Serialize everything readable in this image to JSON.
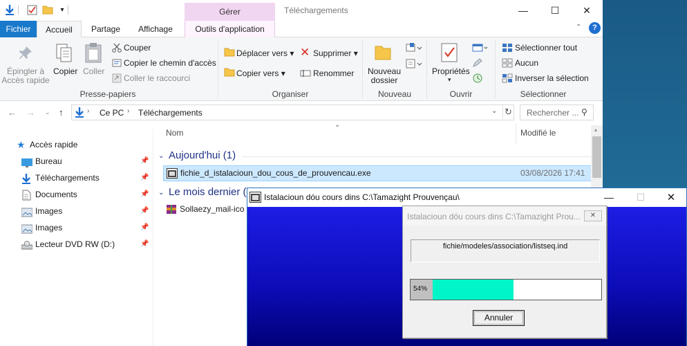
{
  "window": {
    "title": "Téléchargements",
    "contextual_tab_group": "Gérer",
    "minimize_icon": "minimize-icon",
    "maximize_icon": "maximize-icon",
    "close_icon": "close-icon"
  },
  "ribbon_tabs": [
    {
      "label": "Fichier"
    },
    {
      "label": "Accueil"
    },
    {
      "label": "Partage"
    },
    {
      "label": "Affichage"
    },
    {
      "label": "Outils d'application"
    }
  ],
  "ribbon": {
    "presse_papiers": {
      "label": "Presse-papiers",
      "pin_line1": "Épingler à",
      "pin_line2": "Accès rapide",
      "copy": "Copier",
      "paste": "Coller",
      "cut": "Couper",
      "copy_path": "Copier le chemin d'accès",
      "paste_shortcut": "Coller le raccourci"
    },
    "organiser": {
      "label": "Organiser",
      "move_to": "Déplacer vers",
      "copy_to": "Copier vers",
      "delete": "Supprimer",
      "rename": "Renommer"
    },
    "nouveau": {
      "label": "Nouveau",
      "new_folder_line1": "Nouveau",
      "new_folder_line2": "dossier"
    },
    "ouvrir": {
      "label": "Ouvrir",
      "properties": "Propriétés"
    },
    "selectionner": {
      "label": "Sélectionner",
      "select_all": "Sélectionner tout",
      "select_none": "Aucun",
      "invert": "Inverser la sélection"
    }
  },
  "address": {
    "crumbs": [
      "Ce PC",
      "Téléchargements"
    ],
    "search_placeholder": "Rechercher ..."
  },
  "nav_pane": {
    "quick_access": "Accès rapide",
    "items": [
      {
        "label": "Bureau",
        "icon": "desktop-icon",
        "pinned": true
      },
      {
        "label": "Téléchargements",
        "icon": "download-icon",
        "pinned": true
      },
      {
        "label": "Documents",
        "icon": "documents-icon",
        "pinned": true
      },
      {
        "label": "Images",
        "icon": "pictures-icon",
        "pinned": true
      },
      {
        "label": "Images",
        "icon": "pictures-icon",
        "pinned": true
      },
      {
        "label": "Lecteur DVD RW (D:)",
        "icon": "dvd-drive-icon",
        "pinned": true
      }
    ]
  },
  "file_list": {
    "columns": {
      "name": "Nom",
      "modified": "Modifié le"
    },
    "groups": [
      {
        "label": "Aujourd'hui (1)",
        "files": [
          {
            "name": "fichie_d_istalacioun_dou_cous_de_prouvencau.exe",
            "modified": "03/08/2026 17:41",
            "selected": true
          }
        ]
      },
      {
        "label": "Le mois dernier (1)",
        "files": [
          {
            "name": "Sollaezy_mail-ico",
            "modified": "",
            "selected": false
          }
        ]
      }
    ]
  },
  "installer": {
    "title": "Istalacioun dóu cours dins C:\\Tamazight Prouvençau\\",
    "dialog": {
      "title": "Istalacioun dóu cours dins C:\\Tamazight Prou...",
      "current_file": "fichie/modeles/association/listseq.ind",
      "progress_label": "54%",
      "progress_fraction": 0.54,
      "cancel_label": "Annuler",
      "bar_color": "#00f5c8"
    }
  }
}
